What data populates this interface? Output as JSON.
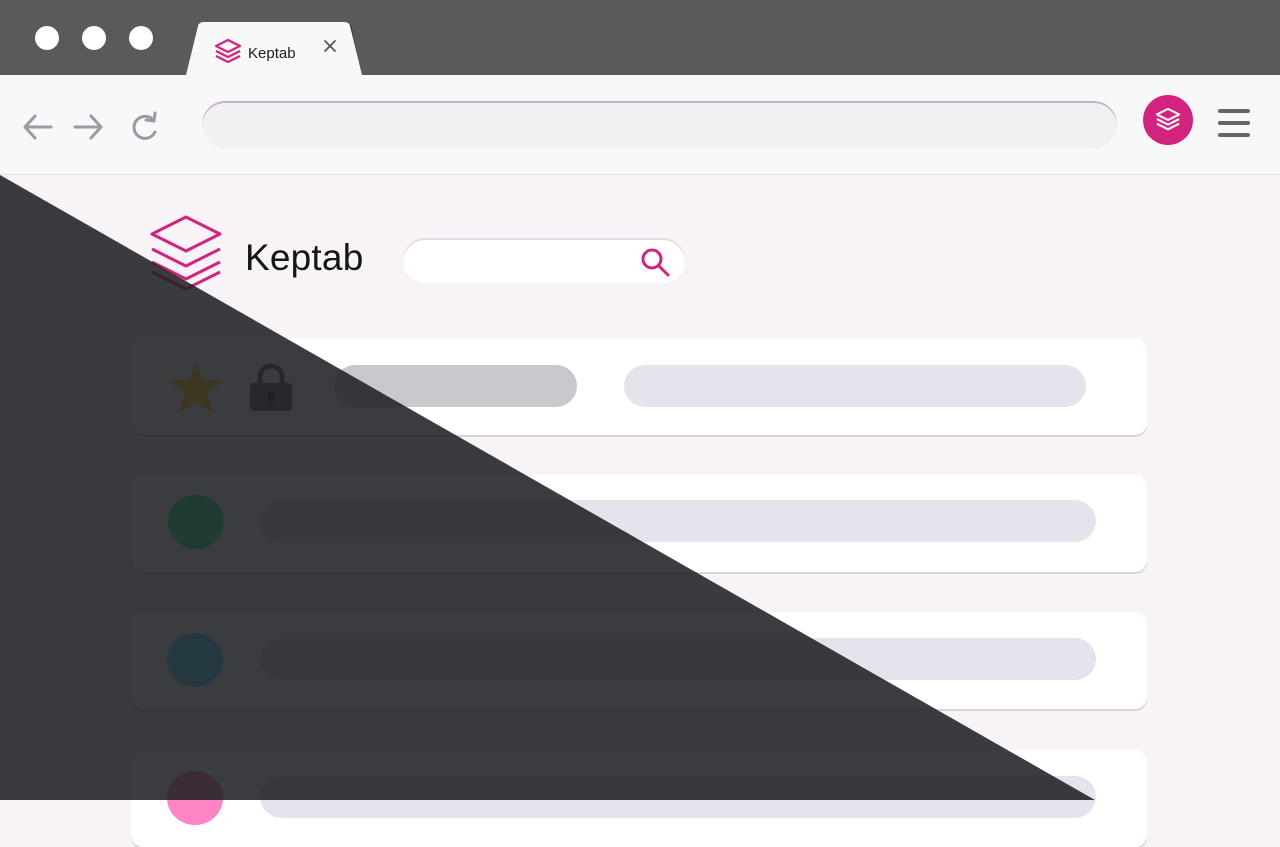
{
  "browser": {
    "tab": {
      "title": "Keptab",
      "icon": "keptab-stack-icon",
      "close_icon": "close-icon"
    },
    "nav": {
      "back_icon": "arrow-left-icon",
      "forward_icon": "arrow-right-icon",
      "reload_icon": "reload-icon"
    },
    "address_bar": {
      "value": ""
    },
    "extension": {
      "icon": "keptab-stack-icon",
      "color": "#d4237f"
    },
    "menu_icon": "hamburger-menu-icon"
  },
  "app": {
    "name": "Keptab",
    "brand_color": "#d4237f",
    "search": {
      "placeholder": "",
      "icon": "search-icon"
    }
  },
  "rows": [
    {
      "type": "pinned",
      "icons": [
        "star-icon",
        "lock-icon"
      ],
      "star_color": "#ffd21f"
    },
    {
      "type": "group",
      "color": "#22f0a0"
    },
    {
      "type": "group",
      "color": "#38e2fb"
    },
    {
      "type": "group",
      "color": "#ff86c2"
    }
  ],
  "theme": {
    "light_bg": "#f7f3f7",
    "dark_bg": "#202124"
  }
}
